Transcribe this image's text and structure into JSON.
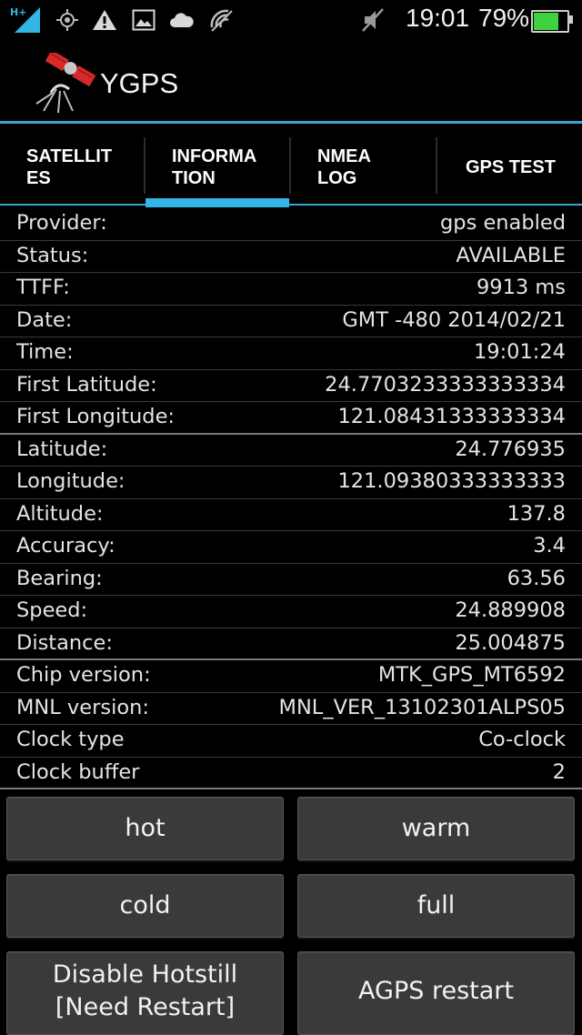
{
  "status_bar": {
    "network_type": "H+",
    "time": "19:01",
    "battery_percent": "79%",
    "battery_level": 0.79,
    "icons": [
      "signal-icon",
      "gps-icon",
      "warning-icon",
      "image-icon",
      "cloud-icon",
      "wifi-off-icon",
      "mute-icon",
      "battery-icon"
    ]
  },
  "app": {
    "title": "YGPS",
    "logo": "satellite-logo"
  },
  "tabs": [
    {
      "label": "SATELLIT\nES",
      "active": false
    },
    {
      "label": "INFORMA\nTION",
      "active": true
    },
    {
      "label": "NMEA\nLOG",
      "active": false
    },
    {
      "label": "GPS TEST",
      "active": false
    }
  ],
  "info_rows": [
    {
      "label": "Provider:",
      "value": "gps enabled"
    },
    {
      "label": "Status:",
      "value": "AVAILABLE"
    },
    {
      "label": "TTFF:",
      "value": "9913 ms"
    },
    {
      "label": "Date:",
      "value": "GMT -480 2014/02/21"
    },
    {
      "label": "Time:",
      "value": "19:01:24"
    },
    {
      "label": "First Latitude:",
      "value": "24.7703233333333334"
    },
    {
      "label": "First Longitude:",
      "value": "121.08431333333334"
    },
    {
      "label": "Latitude:",
      "value": "24.776935"
    },
    {
      "label": "Longitude:",
      "value": "121.09380333333333"
    },
    {
      "label": "Altitude:",
      "value": "137.8"
    },
    {
      "label": "Accuracy:",
      "value": "3.4"
    },
    {
      "label": "Bearing:",
      "value": "63.56"
    },
    {
      "label": "Speed:",
      "value": "24.889908"
    },
    {
      "label": "Distance:",
      "value": "25.004875"
    },
    {
      "label": "Chip version:",
      "value": "MTK_GPS_MT6592"
    },
    {
      "label": "MNL version:",
      "value": "MNL_VER_13102301ALPS05"
    },
    {
      "label": "Clock type",
      "value": "Co-clock"
    },
    {
      "label": "Clock buffer",
      "value": "2"
    }
  ],
  "buttons": {
    "hot": "hot",
    "warm": "warm",
    "cold": "cold",
    "full": "full",
    "disable_hotstill": "Disable Hotstill\n[Need Restart]",
    "agps_restart": "AGPS restart"
  }
}
